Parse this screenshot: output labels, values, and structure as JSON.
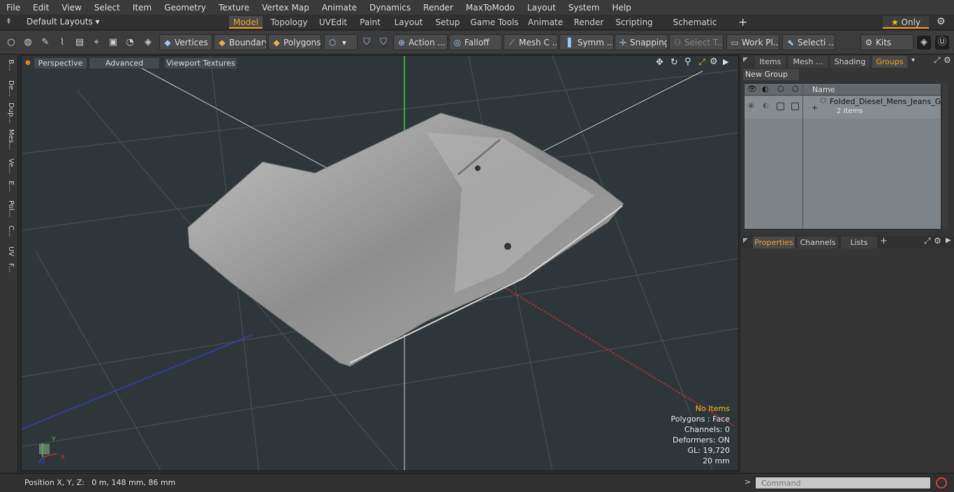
{
  "menu": [
    "File",
    "Edit",
    "View",
    "Select",
    "Item",
    "Geometry",
    "Texture",
    "Vertex Map",
    "Animate",
    "Dynamics",
    "Render",
    "MaxToModo",
    "Layout",
    "System",
    "Help"
  ],
  "layouts": {
    "default_label": "Default Layouts",
    "tabs": [
      "Model",
      "Topology",
      "UVEdit",
      "Paint",
      "Layout",
      "Setup",
      "Game Tools",
      "Animate",
      "Render",
      "Scripting",
      "Schematic Fusion"
    ],
    "active_tab": "Model",
    "only_label": "Only"
  },
  "toolbar": {
    "vertices": "Vertices",
    "boundary": "Boundary",
    "polygons": "Polygons",
    "action": "Action",
    "falloff": "Falloff",
    "mesh_c": "Mesh C ...",
    "symm": "Symm ...",
    "snapping": "Snapping",
    "select_t": "Select T...",
    "work_pl": "Work Pl...",
    "selecti": "Selecti ...",
    "kits": "Kits"
  },
  "left_strip": [
    "B...",
    "De...",
    "Dup...",
    "Mes...",
    "Ve...",
    "E...",
    "Pol...",
    "C...",
    "UV",
    "F..."
  ],
  "viewport": {
    "perspective": "Perspective",
    "advanced": "Advanced",
    "textures": "Viewport Textures",
    "hud": {
      "no_items": "No Items",
      "polygons": "Polygons : Face",
      "channels": "Channels: 0",
      "deformers": "Deformers: ON",
      "gl": "GL: 19,720",
      "scale": "20 mm"
    },
    "axis_x": "X",
    "axis_y": "Y",
    "axis_z": "Z"
  },
  "right_panel": {
    "top_tabs": [
      "Items",
      "Mesh ...",
      "Shading",
      "Groups"
    ],
    "active_top_tab": "Groups",
    "new_group": "New Group",
    "col_name": "Name",
    "group_name": "Folded_Diesel_Mens_Jeans_G...",
    "group_count": "2 Items",
    "bottom_tabs": [
      "Properties",
      "Channels",
      "Lists"
    ],
    "active_bottom_tab": "Properties"
  },
  "status": {
    "position": "Position X, Y, Z:   0 m, 148 mm, 86 mm",
    "command_placeholder": "Command"
  }
}
